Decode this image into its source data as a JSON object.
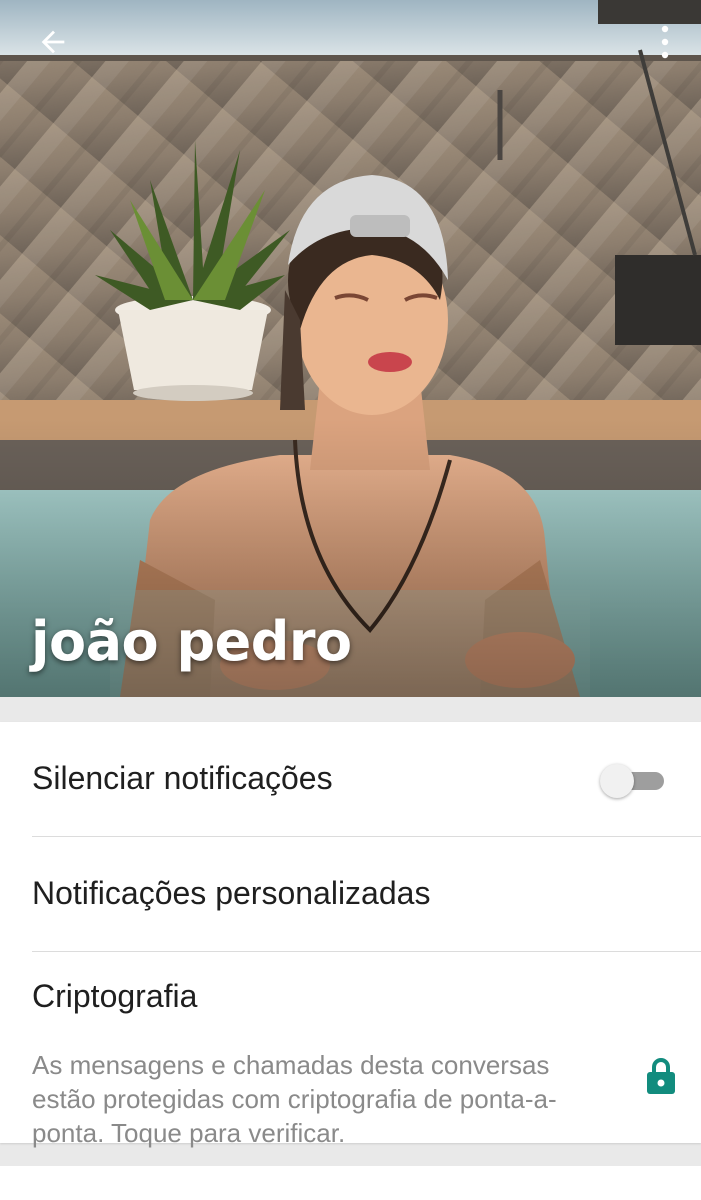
{
  "contact": {
    "name": "joão pedro"
  },
  "toolbar": {
    "back_icon": "arrow-left-icon",
    "more_icon": "more-vert-icon"
  },
  "settings": {
    "mute_label": "Silenciar notificações",
    "mute_enabled": false,
    "custom_notifications_label": "Notificações personalizadas",
    "encryption_label": "Criptografia",
    "encryption_description": "As mensagens e chamadas desta conversas estão protegidas com criptografia de ponta-a-ponta. Toque para verificar.",
    "encryption_icon": "lock-icon"
  },
  "colors": {
    "accent": "#128c7e",
    "toggle_track": "#9e9e9e",
    "toggle_thumb": "#f1f1f1"
  }
}
